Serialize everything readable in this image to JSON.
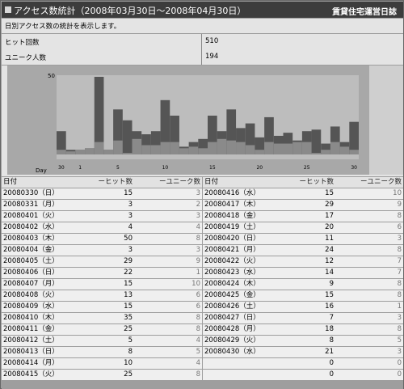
{
  "header": {
    "title": "アクセス数統計（2008年03月30日～2008年04月30日）",
    "site_name": "賃貸住宅運営日誌"
  },
  "description": "日別アクセス数の統計を表示します。",
  "stats": [
    {
      "label": "ヒット回数",
      "value": "510"
    },
    {
      "label": "ユニーク人数",
      "value": "194"
    }
  ],
  "colors": {
    "hits_bar": "#555555",
    "unique_bar": "#8a8a8a",
    "plot_bg": "#bdbdbd"
  },
  "chart_data": {
    "type": "bar",
    "y_max_label": "50",
    "x_axis_label": "Day",
    "ylim": [
      0,
      50
    ],
    "categories": [
      "30",
      "31",
      "1",
      "2",
      "3",
      "4",
      "5",
      "6",
      "7",
      "8",
      "9",
      "10",
      "11",
      "12",
      "13",
      "14",
      "15",
      "16",
      "17",
      "18",
      "19",
      "20",
      "21",
      "22",
      "23",
      "24",
      "25",
      "26",
      "27",
      "28",
      "29",
      "30"
    ],
    "tick_labels": [
      {
        "index": 0,
        "label": "30"
      },
      {
        "index": 2,
        "label": "1"
      },
      {
        "index": 6,
        "label": "5"
      },
      {
        "index": 11,
        "label": "10"
      },
      {
        "index": 16,
        "label": "15"
      },
      {
        "index": 21,
        "label": "20"
      },
      {
        "index": 26,
        "label": "25"
      },
      {
        "index": 31,
        "label": "30"
      }
    ],
    "series": [
      {
        "name": "ヒット数",
        "values": [
          15,
          3,
          3,
          4,
          50,
          3,
          29,
          22,
          15,
          13,
          15,
          35,
          25,
          5,
          8,
          10,
          25,
          15,
          29,
          17,
          20,
          11,
          24,
          12,
          14,
          9,
          15,
          16,
          7,
          18,
          8,
          21
        ]
      },
      {
        "name": "ユニーク数",
        "values": [
          3,
          2,
          3,
          4,
          8,
          3,
          9,
          1,
          10,
          6,
          6,
          8,
          8,
          4,
          5,
          4,
          8,
          10,
          9,
          8,
          6,
          3,
          8,
          7,
          7,
          8,
          8,
          1,
          3,
          8,
          5,
          3
        ]
      }
    ]
  },
  "table": {
    "headers": {
      "date": "日付",
      "hits": "ーヒット数",
      "uniques": "ーユニーク数"
    },
    "left_rows": [
      {
        "date": "20080330（日）",
        "hits": "15",
        "uniques": "3"
      },
      {
        "date": "20080331（月）",
        "hits": "3",
        "uniques": "2"
      },
      {
        "date": "20080401（火）",
        "hits": "3",
        "uniques": "3"
      },
      {
        "date": "20080402（水）",
        "hits": "4",
        "uniques": "4"
      },
      {
        "date": "20080403（木）",
        "hits": "50",
        "uniques": "8"
      },
      {
        "date": "20080404（金）",
        "hits": "3",
        "uniques": "3"
      },
      {
        "date": "20080405（土）",
        "hits": "29",
        "uniques": "9"
      },
      {
        "date": "20080406（日）",
        "hits": "22",
        "uniques": "1"
      },
      {
        "date": "20080407（月）",
        "hits": "15",
        "uniques": "10"
      },
      {
        "date": "20080408（火）",
        "hits": "13",
        "uniques": "6"
      },
      {
        "date": "20080409（水）",
        "hits": "15",
        "uniques": "6"
      },
      {
        "date": "20080410（木）",
        "hits": "35",
        "uniques": "8"
      },
      {
        "date": "20080411（金）",
        "hits": "25",
        "uniques": "8"
      },
      {
        "date": "20080412（土）",
        "hits": "5",
        "uniques": "4"
      },
      {
        "date": "20080413（日）",
        "hits": "8",
        "uniques": "5"
      },
      {
        "date": "20080414（月）",
        "hits": "10",
        "uniques": "4"
      },
      {
        "date": "20080415（火）",
        "hits": "25",
        "uniques": "8"
      }
    ],
    "right_rows": [
      {
        "date": "20080416（水）",
        "hits": "15",
        "uniques": "10"
      },
      {
        "date": "20080417（木）",
        "hits": "29",
        "uniques": "9"
      },
      {
        "date": "20080418（金）",
        "hits": "17",
        "uniques": "8"
      },
      {
        "date": "20080419（土）",
        "hits": "20",
        "uniques": "6"
      },
      {
        "date": "20080420（日）",
        "hits": "11",
        "uniques": "3"
      },
      {
        "date": "20080421（月）",
        "hits": "24",
        "uniques": "8"
      },
      {
        "date": "20080422（火）",
        "hits": "12",
        "uniques": "7"
      },
      {
        "date": "20080423（水）",
        "hits": "14",
        "uniques": "7"
      },
      {
        "date": "20080424（木）",
        "hits": "9",
        "uniques": "8"
      },
      {
        "date": "20080425（金）",
        "hits": "15",
        "uniques": "8"
      },
      {
        "date": "20080426（土）",
        "hits": "16",
        "uniques": "1"
      },
      {
        "date": "20080427（日）",
        "hits": "7",
        "uniques": "3"
      },
      {
        "date": "20080428（月）",
        "hits": "18",
        "uniques": "8"
      },
      {
        "date": "20080429（火）",
        "hits": "8",
        "uniques": "5"
      },
      {
        "date": "20080430（水）",
        "hits": "21",
        "uniques": "3"
      },
      {
        "date": "",
        "hits": "0",
        "uniques": "0"
      },
      {
        "date": "",
        "hits": "0",
        "uniques": "0"
      }
    ]
  }
}
